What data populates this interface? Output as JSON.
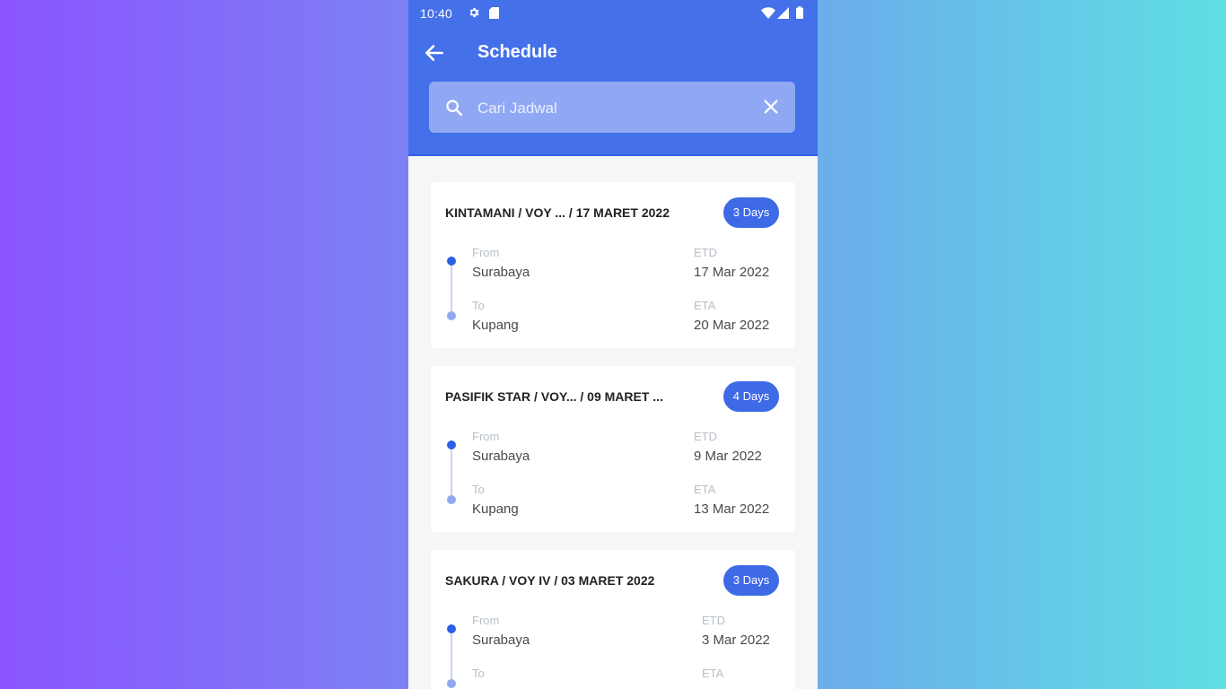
{
  "status_bar": {
    "time": "10:40"
  },
  "app_bar": {
    "title": "Schedule"
  },
  "search": {
    "placeholder": "Cari Jadwal",
    "value": ""
  },
  "labels": {
    "from": "From",
    "to": "To",
    "etd": "ETD",
    "eta": "ETA"
  },
  "colors": {
    "primary": "#4470ea",
    "badge": "#3f6ae6",
    "search_bg": "#90a8f4"
  },
  "schedules": [
    {
      "title": "KINTAMANI / VOY ... / 17 MARET 2022",
      "duration": "3 Days",
      "from": "Surabaya",
      "to": "Kupang",
      "etd": "17 Mar 2022",
      "eta": "20 Mar 2022"
    },
    {
      "title": "PASIFIK STAR / VOY... / 09 MARET ...",
      "duration": "4 Days",
      "from": "Surabaya",
      "to": "Kupang",
      "etd": "9 Mar 2022",
      "eta": "13 Mar 2022"
    },
    {
      "title": "SAKURA / VOY IV / 03 MARET 2022",
      "duration": "3 Days",
      "from": "Surabaya",
      "to": "",
      "etd": "3 Mar 2022",
      "eta": ""
    }
  ]
}
